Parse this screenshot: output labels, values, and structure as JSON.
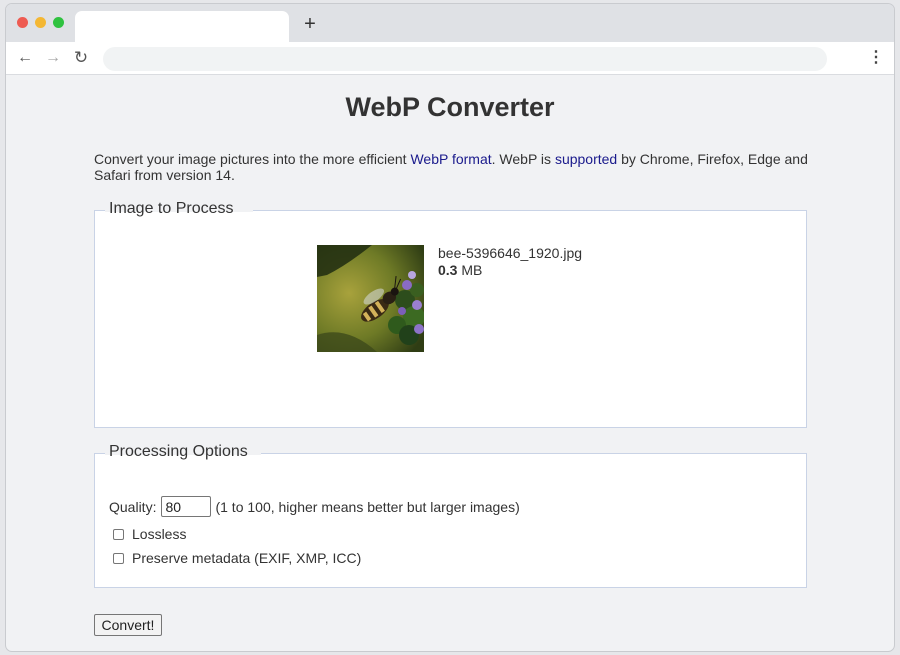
{
  "browser": {
    "new_tab_symbol": "+",
    "back_symbol": "←",
    "forward_symbol": "→",
    "reload_symbol": "↻",
    "menu_symbol": "⋮",
    "address_value": ""
  },
  "page": {
    "title": "WebP Converter",
    "intro": {
      "part1": "Convert your image pictures into the more efficient ",
      "link1": "WebP format",
      "part2": ". WebP is ",
      "link2": "supported",
      "part3": " by Chrome, Firefox, Edge and Safari from version 14."
    }
  },
  "image_section": {
    "legend": "Image to Process",
    "file_name": "bee-5396646_1920.jpg",
    "file_size_value": "0.3",
    "file_size_unit": " MB"
  },
  "options_section": {
    "legend": "Processing Options",
    "quality_label": "Quality:",
    "quality_value": "80",
    "quality_hint": "(1 to 100, higher means better but larger images)",
    "lossless_label": "Lossless",
    "metadata_label": "Preserve metadata (EXIF, XMP, ICC)"
  },
  "convert_button": "Convert!",
  "colors": {
    "link": "#1a1a8c",
    "fieldset_border": "#c9d3e6",
    "close_dot": "#ee5b52",
    "minimize_dot": "#f4b733",
    "maximize_dot": "#2fc240"
  }
}
